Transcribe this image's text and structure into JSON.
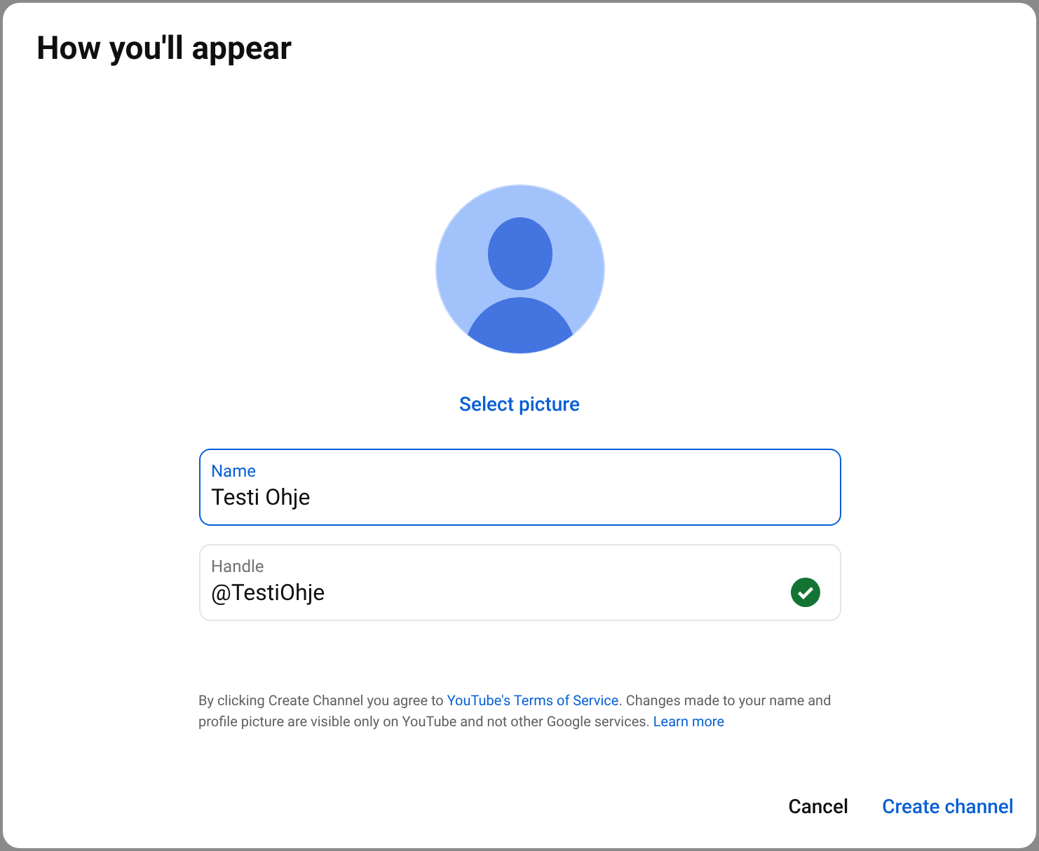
{
  "dialog": {
    "title": "How you'll appear",
    "select_picture": "Select picture",
    "fields": [
      {
        "label": "Name",
        "value": "Testi Ohje",
        "focused": true,
        "valid": false
      },
      {
        "label": "Handle",
        "value": "@TestiOhje",
        "focused": false,
        "valid": true
      }
    ],
    "legal": {
      "text_before": "By clicking Create Channel you agree to ",
      "terms_link": "YouTube's Terms of Service",
      "text_after": ". Changes made to your name and profile picture are visible only on YouTube and not other Google services. ",
      "learn_more_link": "Learn more"
    },
    "buttons": [
      {
        "label": "Cancel",
        "kind": "secondary"
      },
      {
        "label": "Create channel",
        "kind": "primary"
      }
    ]
  }
}
